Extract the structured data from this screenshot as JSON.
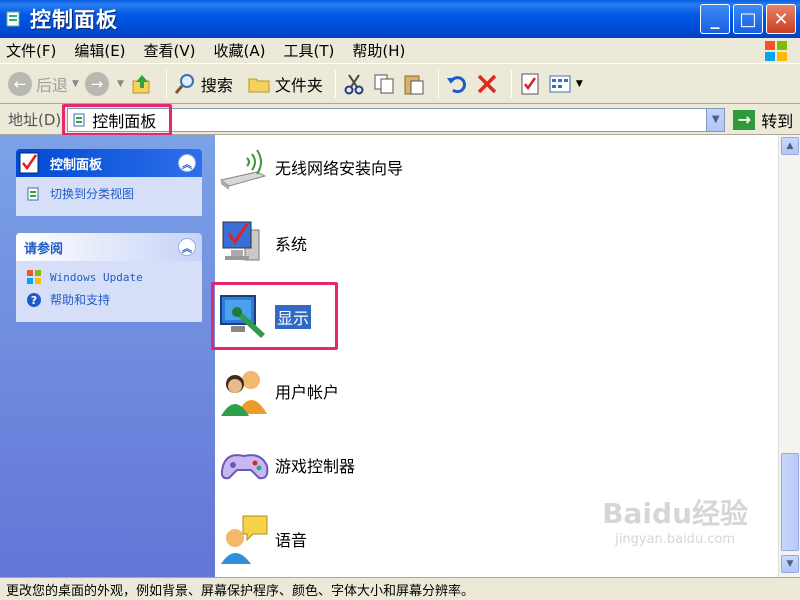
{
  "window": {
    "title": "控制面板"
  },
  "menubar": {
    "items": [
      "文件(F)",
      "编辑(E)",
      "查看(V)",
      "收藏(A)",
      "工具(T)",
      "帮助(H)"
    ]
  },
  "toolbar": {
    "back": "后退",
    "search": "搜索",
    "folders": "文件夹"
  },
  "address": {
    "label": "地址(D)",
    "value": "控制面板",
    "go": "转到"
  },
  "sidebar": {
    "panel1": {
      "title": "控制面板",
      "link": "切换到分类视图"
    },
    "panel2": {
      "title": "请参阅",
      "links": [
        "Windows Update",
        "帮助和支持"
      ]
    }
  },
  "items": [
    {
      "label": "无线网络安装向导",
      "icon": "wireless-icon"
    },
    {
      "label": "系统",
      "icon": "system-icon"
    },
    {
      "label": "显示",
      "icon": "display-icon"
    },
    {
      "label": "用户帐户",
      "icon": "users-icon"
    },
    {
      "label": "游戏控制器",
      "icon": "gamepad-icon"
    },
    {
      "label": "语音",
      "icon": "speech-icon"
    }
  ],
  "statusbar": {
    "text": "更改您的桌面的外观，例如背景、屏幕保护程序、颜色、字体大小和屏幕分辨率。"
  },
  "watermark": {
    "main": "Baidu经验",
    "sub": "jingyan.baidu.com"
  }
}
